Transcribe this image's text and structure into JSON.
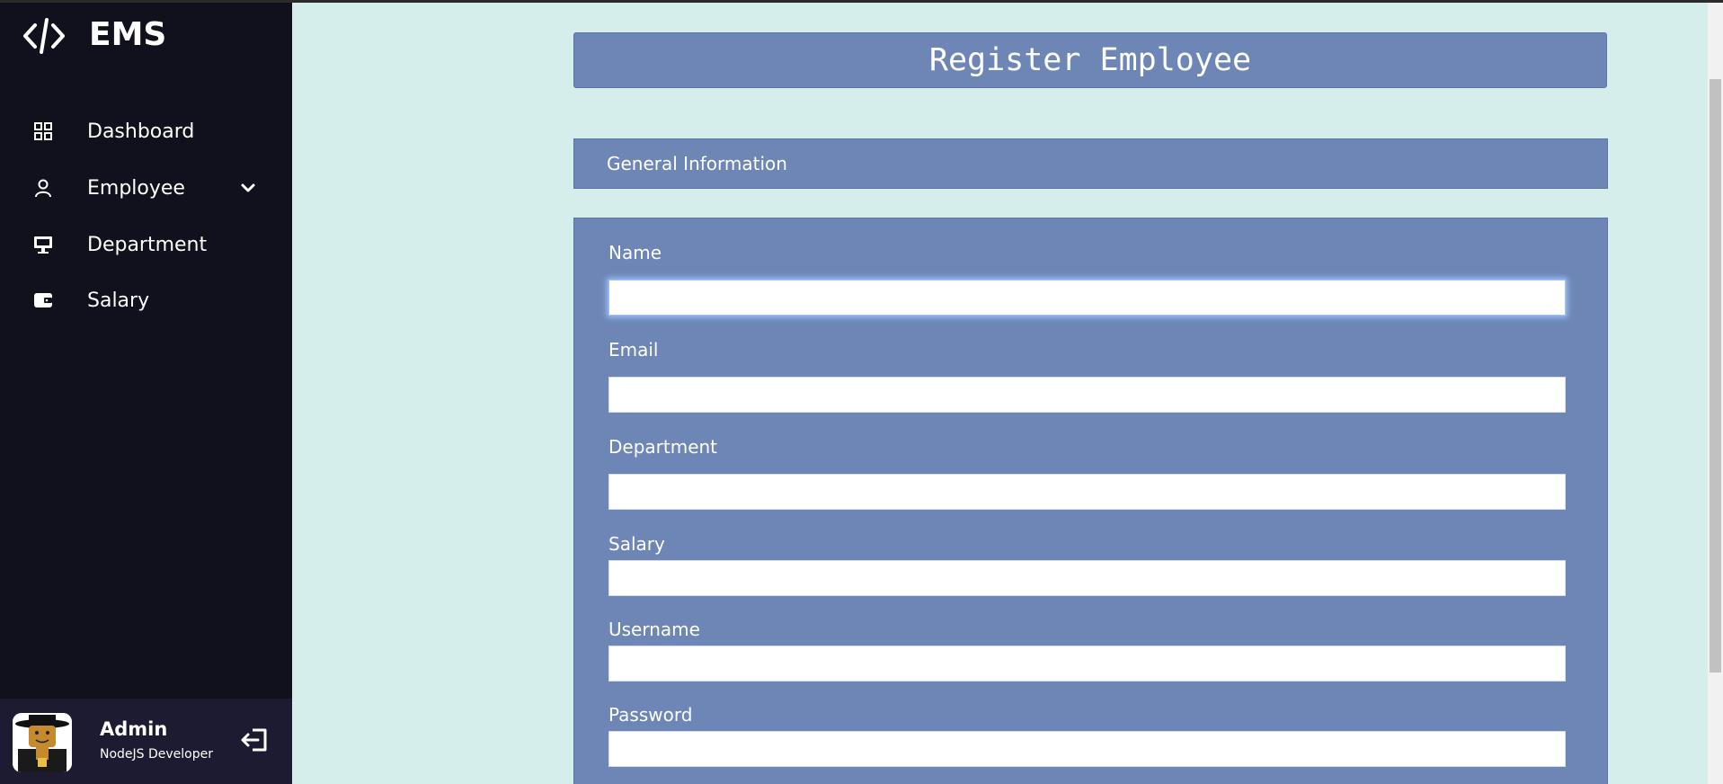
{
  "sidebar": {
    "brand": "EMS",
    "items": [
      {
        "label": "Dashboard"
      },
      {
        "label": "Employee"
      },
      {
        "label": "Department"
      },
      {
        "label": "Salary"
      }
    ],
    "profile": {
      "name": "Admin",
      "job": "NodeJS Developer"
    }
  },
  "main": {
    "title": "Register Employee",
    "section": "General Information",
    "fields": [
      {
        "label": "Name",
        "value": ""
      },
      {
        "label": "Email",
        "value": ""
      },
      {
        "label": "Department",
        "value": ""
      },
      {
        "label": "Salary",
        "value": ""
      },
      {
        "label": "Username",
        "value": ""
      },
      {
        "label": "Password",
        "value": ""
      }
    ]
  },
  "colors": {
    "sidebar_bg": "#11101d",
    "profile_bg": "#1d1b31",
    "page_bg": "#d5eeeb",
    "panel_bg": "#6e86b6"
  }
}
